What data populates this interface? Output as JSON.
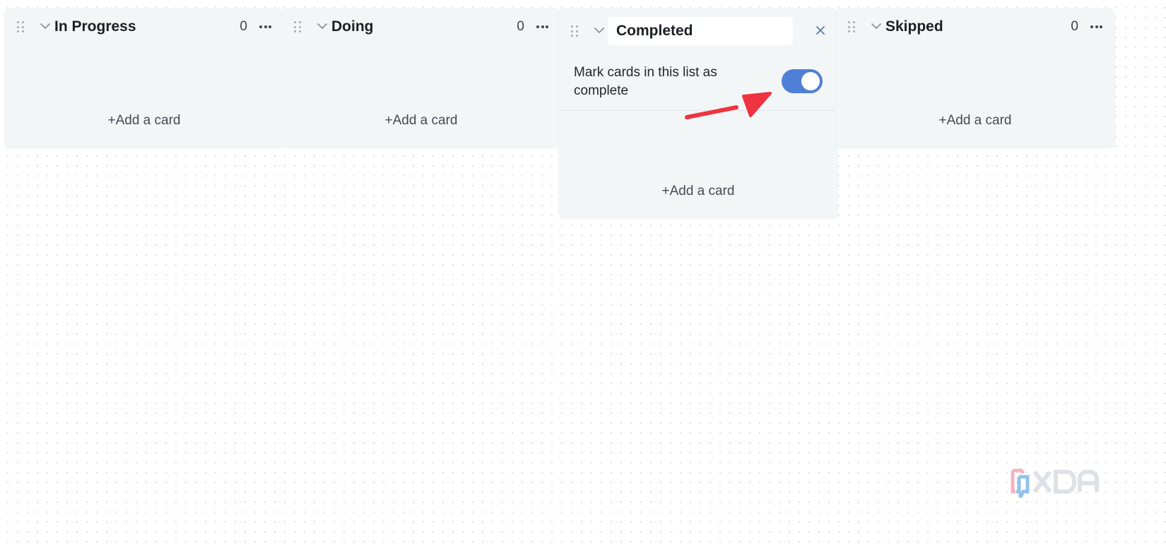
{
  "board": {
    "columns": [
      {
        "title": "In Progress",
        "count": "0",
        "add_label": "+Add a card"
      },
      {
        "title": "Doing",
        "count": "0",
        "add_label": "+Add a card"
      },
      {
        "title": "Completed",
        "setting_label": "Mark cards in this list as complete",
        "toggle_on": true,
        "add_label": "+Add a card"
      },
      {
        "title": "Skipped",
        "count": "0",
        "add_label": "+Add a card"
      }
    ]
  },
  "watermark": {
    "text": "XDA"
  },
  "colors": {
    "column_bg": "#f3f6f7",
    "toggle_on": "#4f7fd6",
    "annotation_arrow": "#ef3340",
    "close_icon": "#5b7fb3"
  },
  "icons": [
    "drag-handle-icon",
    "chevron-down-icon",
    "more-icon",
    "close-icon",
    "toggle-switch",
    "annotation-arrow",
    "xda-logo"
  ]
}
